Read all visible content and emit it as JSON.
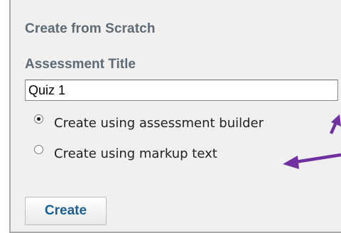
{
  "panel": {
    "section_title": "Create from Scratch"
  },
  "form": {
    "field_label": "Assessment Title",
    "title_value": "Quiz 1",
    "options": [
      {
        "label": "Create using assessment builder",
        "selected": true
      },
      {
        "label": "Create using markup text",
        "selected": false
      }
    ],
    "submit_label": "Create"
  },
  "annotations": {
    "arrow_color": "#7030a0",
    "arrow_icon": "arrow-left-icon"
  },
  "colors": {
    "label_text": "#5e6b75",
    "button_text": "#1c5f91",
    "panel_background": "#f0f0f0"
  }
}
